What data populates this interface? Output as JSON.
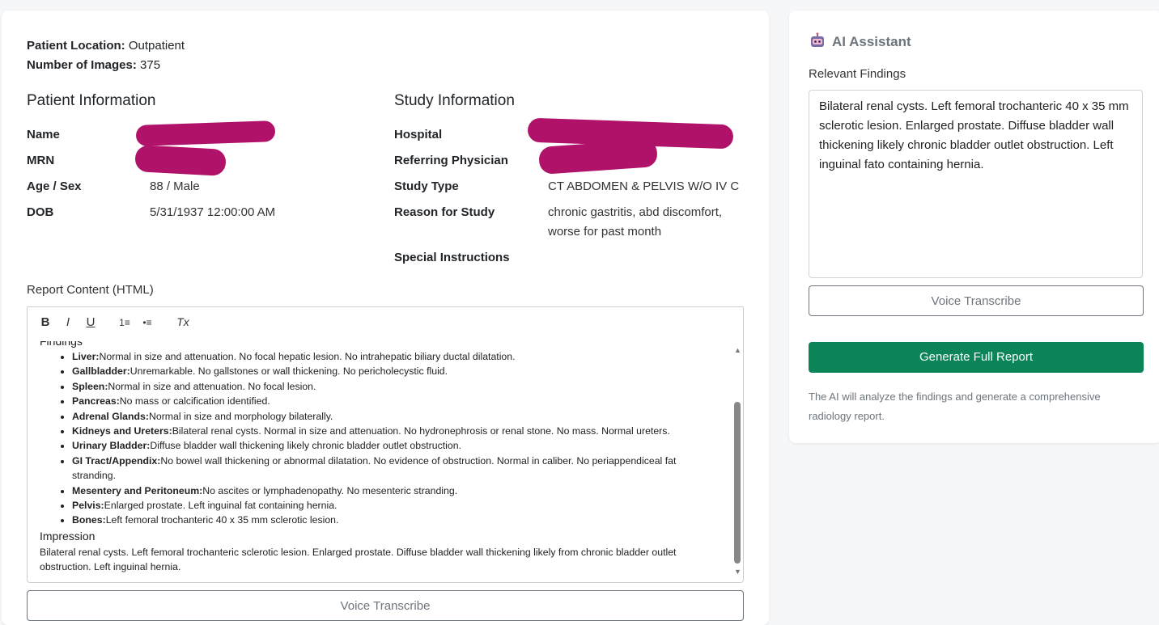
{
  "header": {
    "location_label": "Patient Location:",
    "location_value": "Outpatient",
    "images_label": "Number of Images:",
    "images_value": "375"
  },
  "patient": {
    "title": "Patient Information",
    "name_label": "Name",
    "mrn_label": "MRN",
    "age_label": "Age / Sex",
    "age_value": "88 / Male",
    "dob_label": "DOB",
    "dob_value": "5/31/1937 12:00:00 AM"
  },
  "study": {
    "title": "Study Information",
    "hospital_label": "Hospital",
    "referring_label": "Referring Physician",
    "type_label": "Study Type",
    "type_value": "CT ABDOMEN & PELVIS W/O IV C",
    "reason_label": "Reason for Study",
    "reason_line1": "chronic gastritis, abd discomfort,",
    "reason_line2": "worse for past month",
    "special_label": "Special Instructions"
  },
  "report": {
    "label": "Report Content (HTML)",
    "toolbar": {
      "bold": "B",
      "italic": "I",
      "underline": "U",
      "ordered": "1≡",
      "bullet": "•≡",
      "clear": "Tx"
    },
    "findings_heading": "Findings",
    "findings": [
      {
        "organ": "Liver:",
        "text": "Normal in size and attenuation. No focal hepatic lesion. No intrahepatic biliary ductal dilatation."
      },
      {
        "organ": "Gallbladder:",
        "text": "Unremarkable. No gallstones or wall thickening. No pericholecystic fluid."
      },
      {
        "organ": "Spleen:",
        "text": "Normal in size and attenuation. No focal lesion."
      },
      {
        "organ": "Pancreas:",
        "text": "No mass or calcification identified."
      },
      {
        "organ": "Adrenal Glands:",
        "text": "Normal in size and morphology bilaterally."
      },
      {
        "organ": "Kidneys and Ureters:",
        "text": "Bilateral renal cysts. Normal in size and attenuation. No hydronephrosis or renal stone. No mass. Normal ureters."
      },
      {
        "organ": "Urinary Bladder:",
        "text": "Diffuse bladder wall thickening likely chronic bladder outlet obstruction."
      },
      {
        "organ": "GI Tract/Appendix:",
        "text": "No bowel wall thickening or abnormal dilatation. No evidence of obstruction. Normal in caliber. No periappendiceal fat stranding."
      },
      {
        "organ": "Mesentery and Peritoneum:",
        "text": "No ascites or lymphadenopathy. No mesenteric stranding."
      },
      {
        "organ": "Pelvis:",
        "text": "Enlarged prostate. Left inguinal fat containing hernia."
      },
      {
        "organ": "Bones:",
        "text": "Left femoral trochanteric 40 x 35 mm sclerotic lesion."
      }
    ],
    "impression_heading": "Impression",
    "impression_text": "Bilateral renal cysts. Left femoral trochanteric sclerotic lesion. Enlarged prostate. Diffuse bladder wall thickening likely from chronic bladder outlet obstruction. Left inguinal hernia.",
    "voice_label": "Voice Transcribe"
  },
  "ai": {
    "title": "AI Assistant",
    "findings_label": "Relevant Findings",
    "findings_text": "Bilateral renal cysts. Left femoral trochanteric 40 x 35 mm sclerotic lesion. Enlarged prostate. Diffuse bladder wall thickening likely chronic bladder outlet obstruction. Left inguinal fato containing hernia.",
    "voice_label": "Voice Transcribe",
    "generate_label": "Generate Full Report",
    "note": "The AI will analyze the findings and generate a comprehensive radiology report."
  },
  "colors": {
    "redaction": "#b0126a",
    "primary": "#0b8457"
  }
}
